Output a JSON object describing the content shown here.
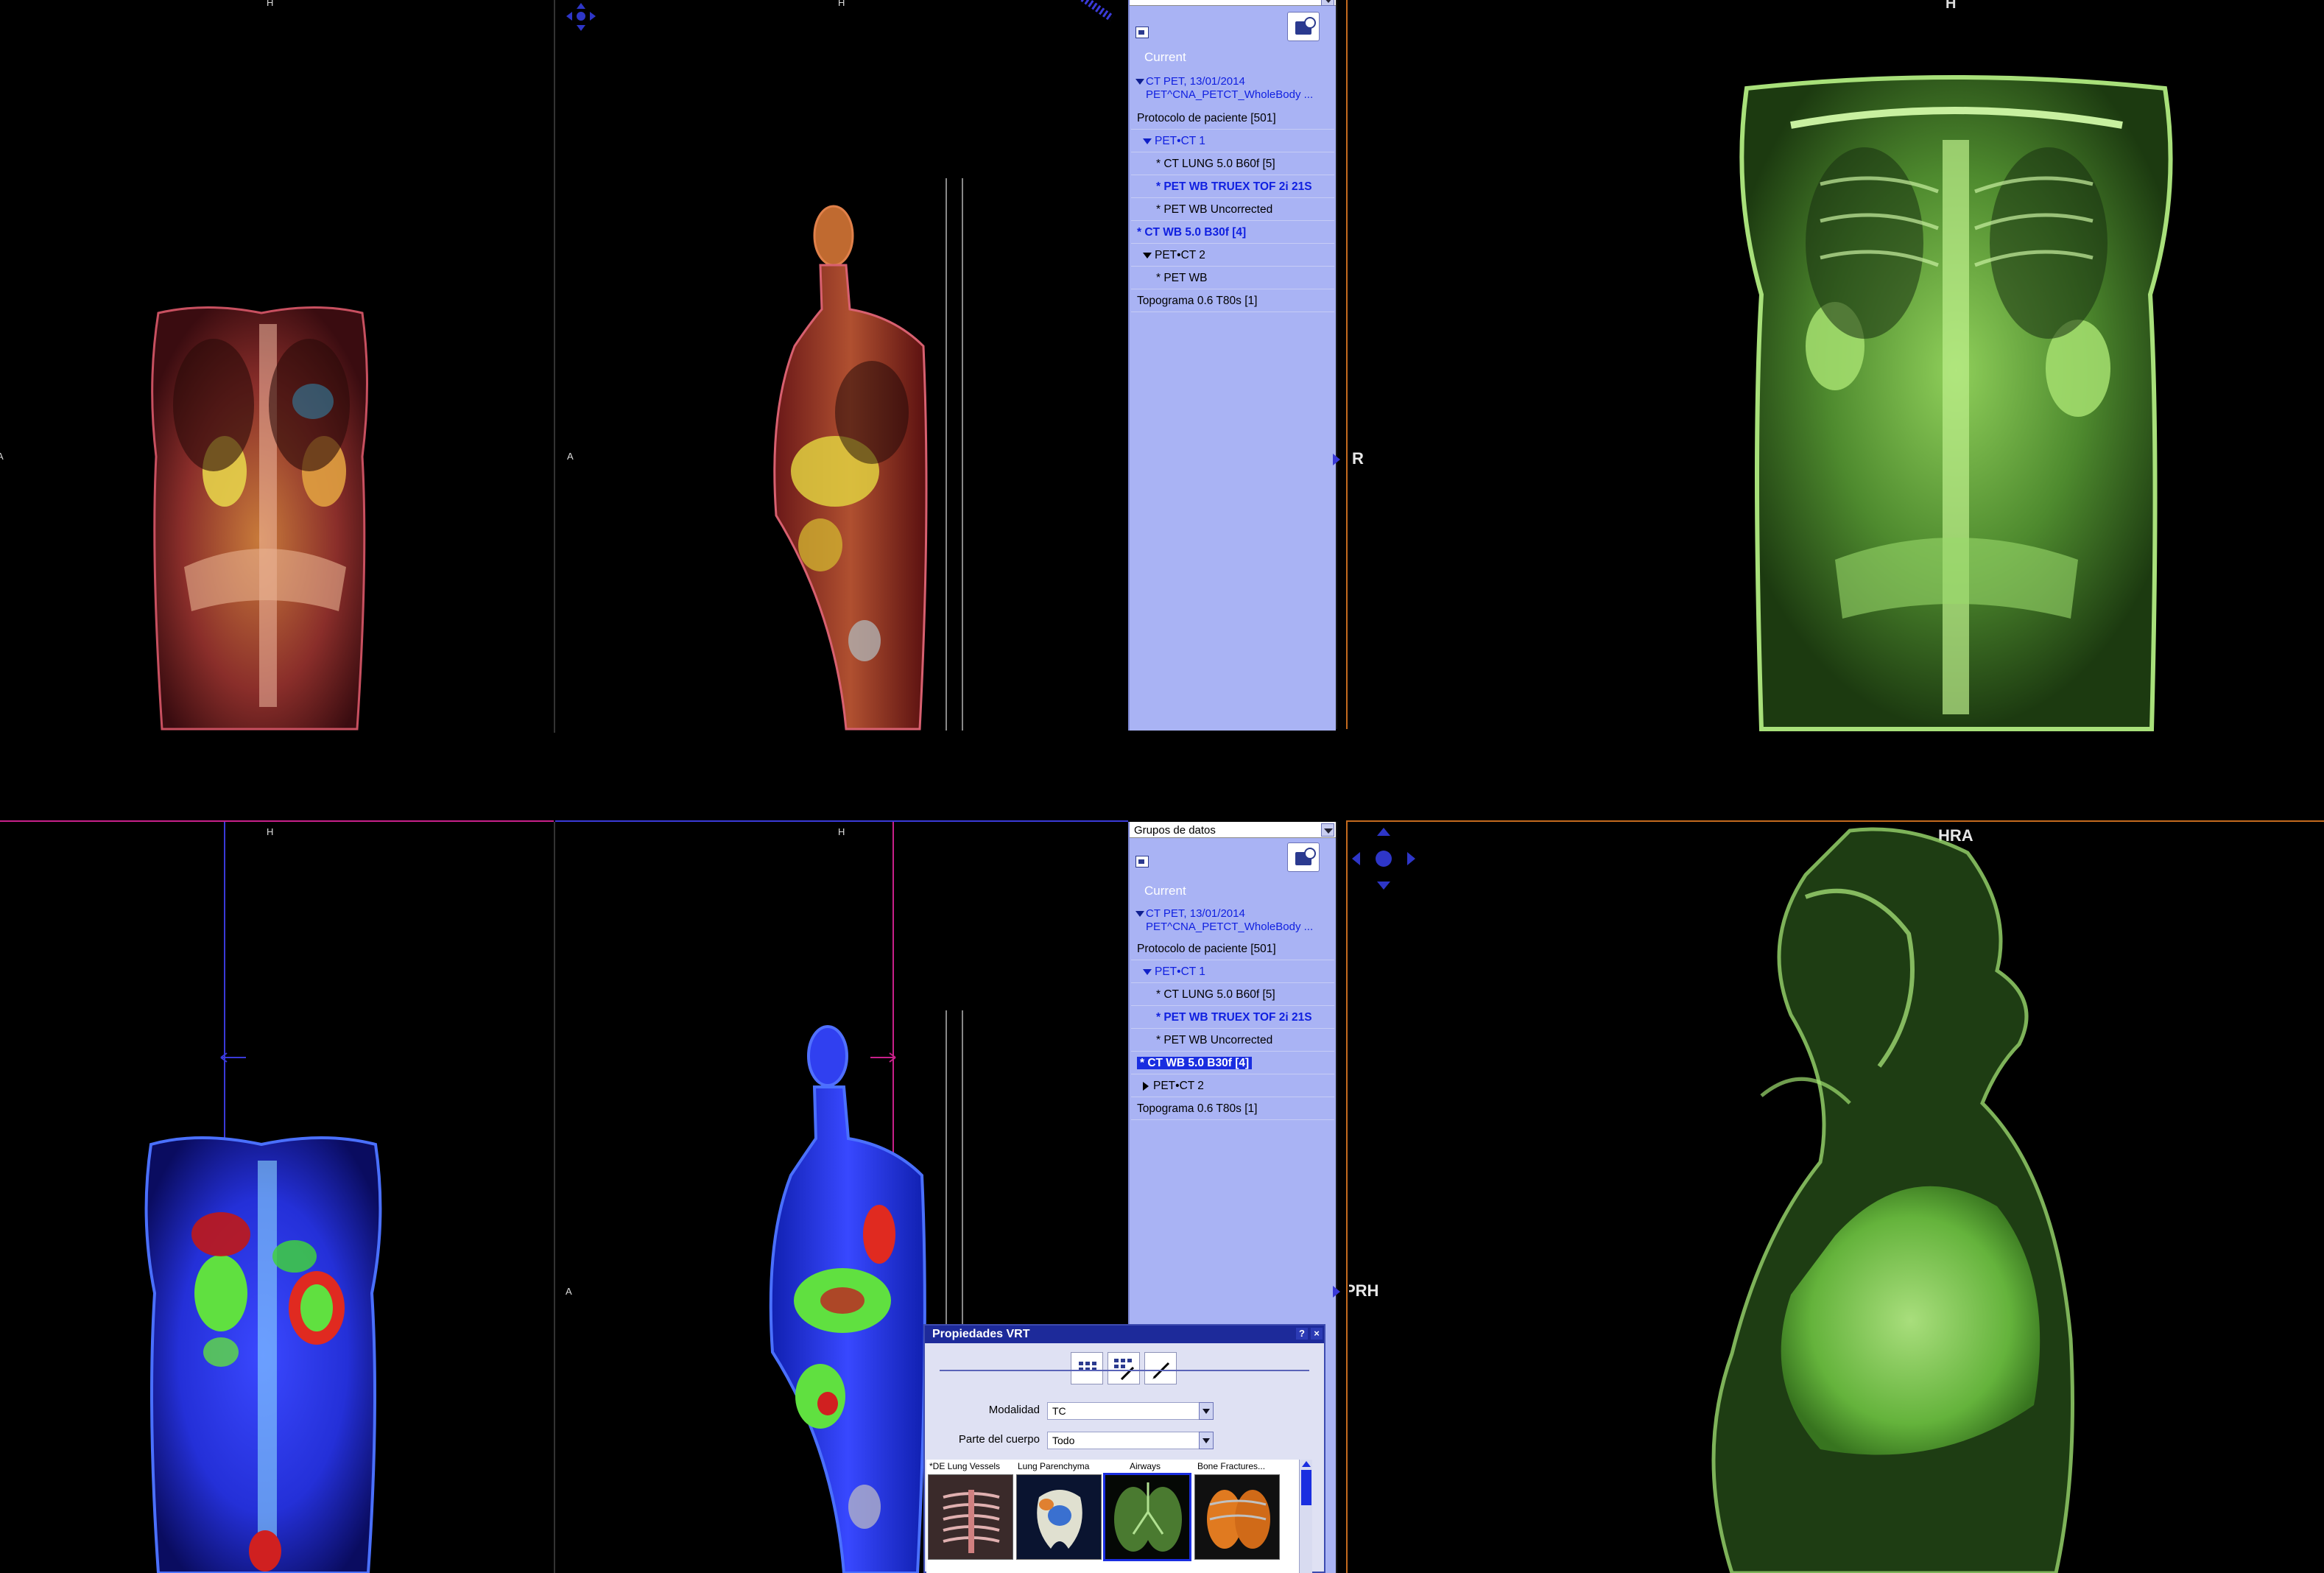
{
  "viewports": {
    "top_left": {
      "top_marker": "H",
      "side_marker": "A"
    },
    "top_middle": {
      "top_marker": "H",
      "side_marker": "A"
    },
    "top_right": {
      "top_marker": "H",
      "side_marker": "R"
    },
    "bottom_left": {
      "top_marker": "H"
    },
    "bottom_middle": {
      "top_marker": "H",
      "side_marker": "A"
    },
    "bottom_right": {
      "top_marker": "HRA",
      "side_marker": "PRH"
    }
  },
  "data_panel_top": {
    "header": "",
    "current_label": "Current",
    "study_line1": "CT PET, 13/01/2014",
    "study_line2": "PET^CNA_PETCT_WholeBody ...",
    "rows": [
      {
        "text": "Protocolo de paciente [501]",
        "style": "normal",
        "indent": 0
      },
      {
        "text": "PET•CT 1",
        "style": "group",
        "indent": 1
      },
      {
        "text": "* CT LUNG  5.0  B60f [5]",
        "style": "normal",
        "indent": 2
      },
      {
        "text": "* PET WB TRUEX TOF 2i 21S",
        "style": "bluebold",
        "indent": 2
      },
      {
        "text": "* PET WB Uncorrected",
        "style": "normal",
        "indent": 2
      },
      {
        "text": "* CT WB  5.0  B30f [4]",
        "style": "bluebold",
        "indent": 0
      },
      {
        "text": "PET•CT 2",
        "style": "group-black",
        "indent": 1
      },
      {
        "text": "* PET WB",
        "style": "normal",
        "indent": 2
      },
      {
        "text": "Topograma  0.6  T80s [1]",
        "style": "normal",
        "indent": 0
      }
    ]
  },
  "data_panel_bottom": {
    "header": "Grupos de datos",
    "current_label": "Current",
    "study_line1": "CT PET, 13/01/2014",
    "study_line2": "PET^CNA_PETCT_WholeBody ...",
    "rows": [
      {
        "text": "Protocolo de paciente [501]",
        "style": "normal",
        "indent": 0
      },
      {
        "text": "PET•CT 1",
        "style": "group",
        "indent": 1
      },
      {
        "text": "* CT LUNG  5.0  B60f [5]",
        "style": "normal",
        "indent": 2
      },
      {
        "text": "* PET WB TRUEX TOF 2i 21S",
        "style": "bluebold",
        "indent": 2
      },
      {
        "text": "* PET WB Uncorrected",
        "style": "normal",
        "indent": 2
      },
      {
        "text": "* CT WB  5.0  B30f [4]",
        "style": "selected",
        "indent": 0
      },
      {
        "text": "PET•CT 2",
        "style": "collapsed",
        "indent": 1
      },
      {
        "text": "Topograma  0.6  T80s [1]",
        "style": "normal",
        "indent": 0
      }
    ]
  },
  "vrt_dialog": {
    "title": "Propiedades VRT",
    "help": "?",
    "close": "×",
    "modality_label": "Modalidad",
    "modality_value": "TC",
    "bodypart_label": "Parte del cuerpo",
    "bodypart_value": "Todo",
    "presets": [
      {
        "label": "*DE Lung Vessels",
        "selected": false
      },
      {
        "label": "Lung Parenchyma",
        "selected": false
      },
      {
        "label": "Airways",
        "selected": true
      },
      {
        "label": "Bone Fractures...",
        "selected": false
      }
    ]
  },
  "colors": {
    "panel_bg": "#a9b3f4",
    "accent_blue": "#1a2ee0",
    "pet_green": "#7be05a",
    "crosshair_magenta": "#c8208a",
    "crosshair_blue": "#3a3ad8",
    "orange_border": "#c46a1e"
  }
}
